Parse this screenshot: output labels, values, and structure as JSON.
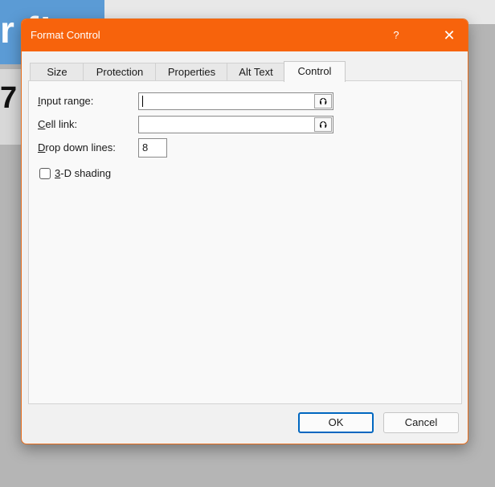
{
  "background": {
    "sheet_fragment_top": "r f!",
    "sheet_fragment_cell": "7",
    "blue_color": "#5b9bd5"
  },
  "dialog": {
    "title": "Format Control",
    "help_glyph": "?",
    "close_glyph": "✕",
    "accent_color": "#f7630c"
  },
  "tabs": [
    {
      "label": "Size",
      "active": false
    },
    {
      "label": "Protection",
      "active": false
    },
    {
      "label": "Properties",
      "active": false
    },
    {
      "label": "Alt Text",
      "active": false
    },
    {
      "label": "Control",
      "active": true
    }
  ],
  "control": {
    "input_range": {
      "label_accel": "I",
      "label_rest": "nput range:",
      "value": ""
    },
    "cell_link": {
      "label_accel": "C",
      "label_rest": "ell link:",
      "value": ""
    },
    "drop_down_lines": {
      "label_accel": "D",
      "label_rest": "rop down lines:",
      "value": "8"
    },
    "shading": {
      "label_accel": "3",
      "label_rest": "-D shading",
      "checked": false
    },
    "picker_glyph": "⮉"
  },
  "buttons": {
    "ok": "OK",
    "cancel": "Cancel"
  }
}
